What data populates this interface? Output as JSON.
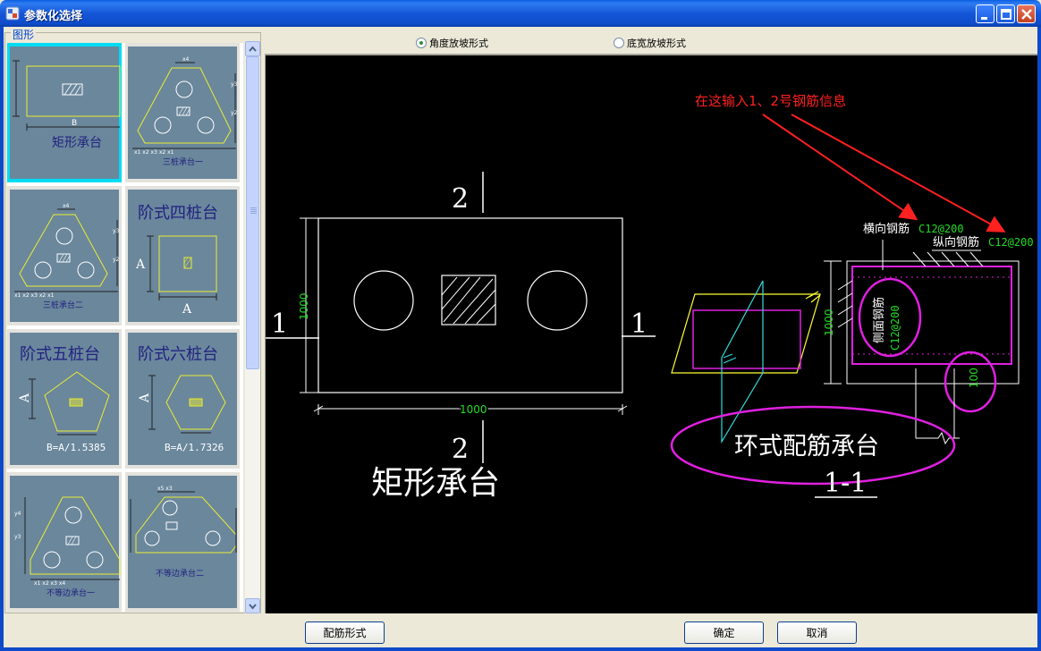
{
  "window": {
    "title": "参数化选择"
  },
  "group": {
    "label": "图形"
  },
  "thumbnails": [
    {
      "caption": "矩形承台",
      "dim_b": "B"
    },
    {
      "caption": "三桩承台一"
    },
    {
      "caption": "三桩承台二"
    },
    {
      "caption": "阶式四桩台",
      "dim_a": "A"
    },
    {
      "caption": "阶式五桩台",
      "formula": "B=A/1.5385",
      "dim_a": "A"
    },
    {
      "caption": "阶式六桩台",
      "formula": "B=A/1.7326",
      "dim_a": "A"
    },
    {
      "caption": "不等边承台一"
    },
    {
      "caption": "不等边承台二"
    }
  ],
  "radio_options": [
    {
      "label": "角度放坡形式",
      "checked": true
    },
    {
      "label": "底宽放坡形式",
      "checked": false
    }
  ],
  "drawing": {
    "annotation": "在这输入1、2号钢筋信息",
    "section_top": "2",
    "section_bottom": "2",
    "section_left": "1",
    "section_right": "1",
    "dim_height": "1000",
    "dim_width": "1000",
    "caption": "矩形承台",
    "horizontal_rebar_label": "横向钢筋",
    "horizontal_rebar_value": "C12@200",
    "longitudinal_rebar_label": "纵向钢筋",
    "longitudinal_rebar_value": "C12@200",
    "side_rebar_label": "侧面钢筋",
    "side_rebar_value": "C12@200",
    "section_dim_height": "1000",
    "cover_dim": "100",
    "ring_caption": "环式配筋承台",
    "section_label": "1-1"
  },
  "buttons": {
    "reinforcement": "配筋形式",
    "ok": "确定",
    "cancel": "取消"
  },
  "colors": {
    "selected_thumb": "#00dcf4",
    "thumb_bg": "#6a879c",
    "annotation_red": "#ff2020",
    "dim_green": "#22dd22",
    "magenta": "#e020e0"
  }
}
